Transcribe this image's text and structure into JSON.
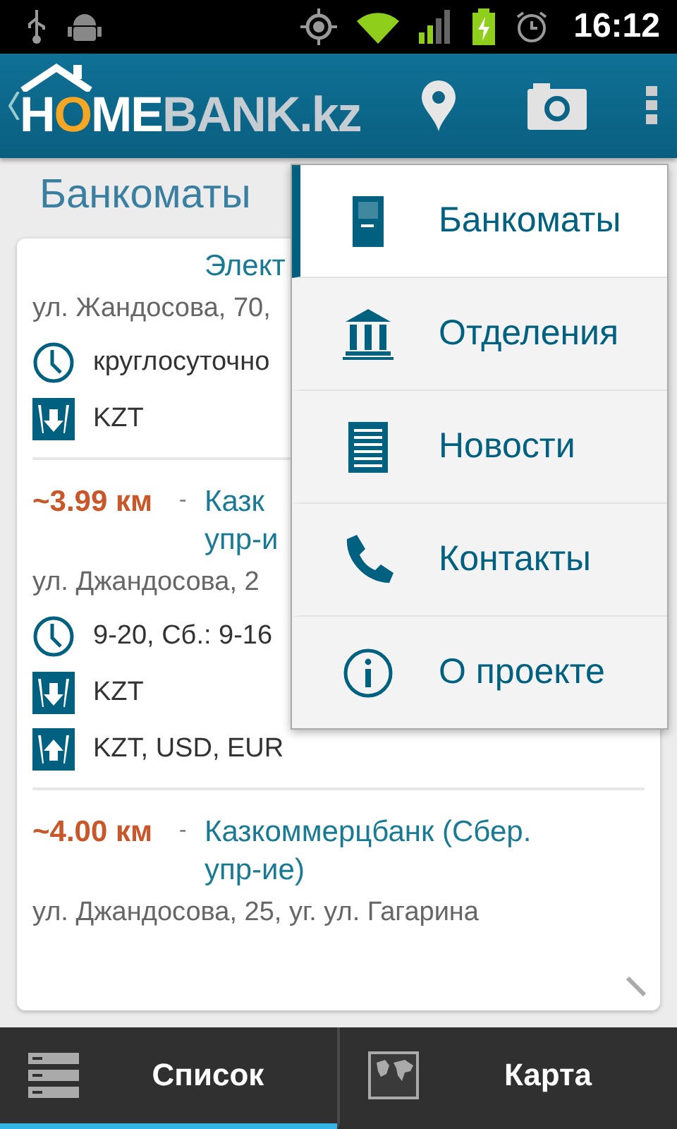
{
  "status_bar": {
    "time": "16:12"
  },
  "app_bar": {
    "logo": [
      {
        "text": "H",
        "color": "#ffffff"
      },
      {
        "text": "O",
        "color": "#f5a623"
      },
      {
        "text": "ME",
        "color": "#ffffff"
      },
      {
        "text": "BANK.kz",
        "color": "#c5ccd2"
      }
    ]
  },
  "page_title": "Банкоматы",
  "atms": [
    {
      "title_lines": [
        "Элект"
      ],
      "address": "ул. Жандосова, 70,",
      "details": [
        {
          "kind": "hours",
          "text": "круглосуточно"
        },
        {
          "kind": "cash_out",
          "text": "KZT"
        }
      ]
    },
    {
      "distance": "~3.99 км",
      "dash": "-",
      "title_lines": [
        "Казк",
        "упр-и"
      ],
      "address": "ул. Джандосова, 2",
      "details": [
        {
          "kind": "hours",
          "text": "9-20, Сб.: 9-16"
        },
        {
          "kind": "cash_out",
          "text": "KZT"
        },
        {
          "kind": "cash_in",
          "text": "KZT, USD, EUR"
        }
      ]
    },
    {
      "distance": "~4.00 км",
      "dash": "-",
      "title_lines": [
        "Казкоммерцбанк (Сбер.",
        "упр-ие)"
      ],
      "address": "ул. Джандосова, 25, уг. ул. Гагарина"
    }
  ],
  "menu": [
    {
      "kind": "atm",
      "label": "Банкоматы",
      "selected": true
    },
    {
      "kind": "bank",
      "label": "Отделения",
      "selected": false
    },
    {
      "kind": "news",
      "label": "Новости",
      "selected": false
    },
    {
      "kind": "phone",
      "label": "Контакты",
      "selected": false
    },
    {
      "kind": "info",
      "label": "О проекте",
      "selected": false
    }
  ],
  "bottom_tabs": [
    {
      "kind": "list",
      "label": "Список",
      "selected": true
    },
    {
      "kind": "map",
      "label": "Карта",
      "selected": false
    }
  ]
}
